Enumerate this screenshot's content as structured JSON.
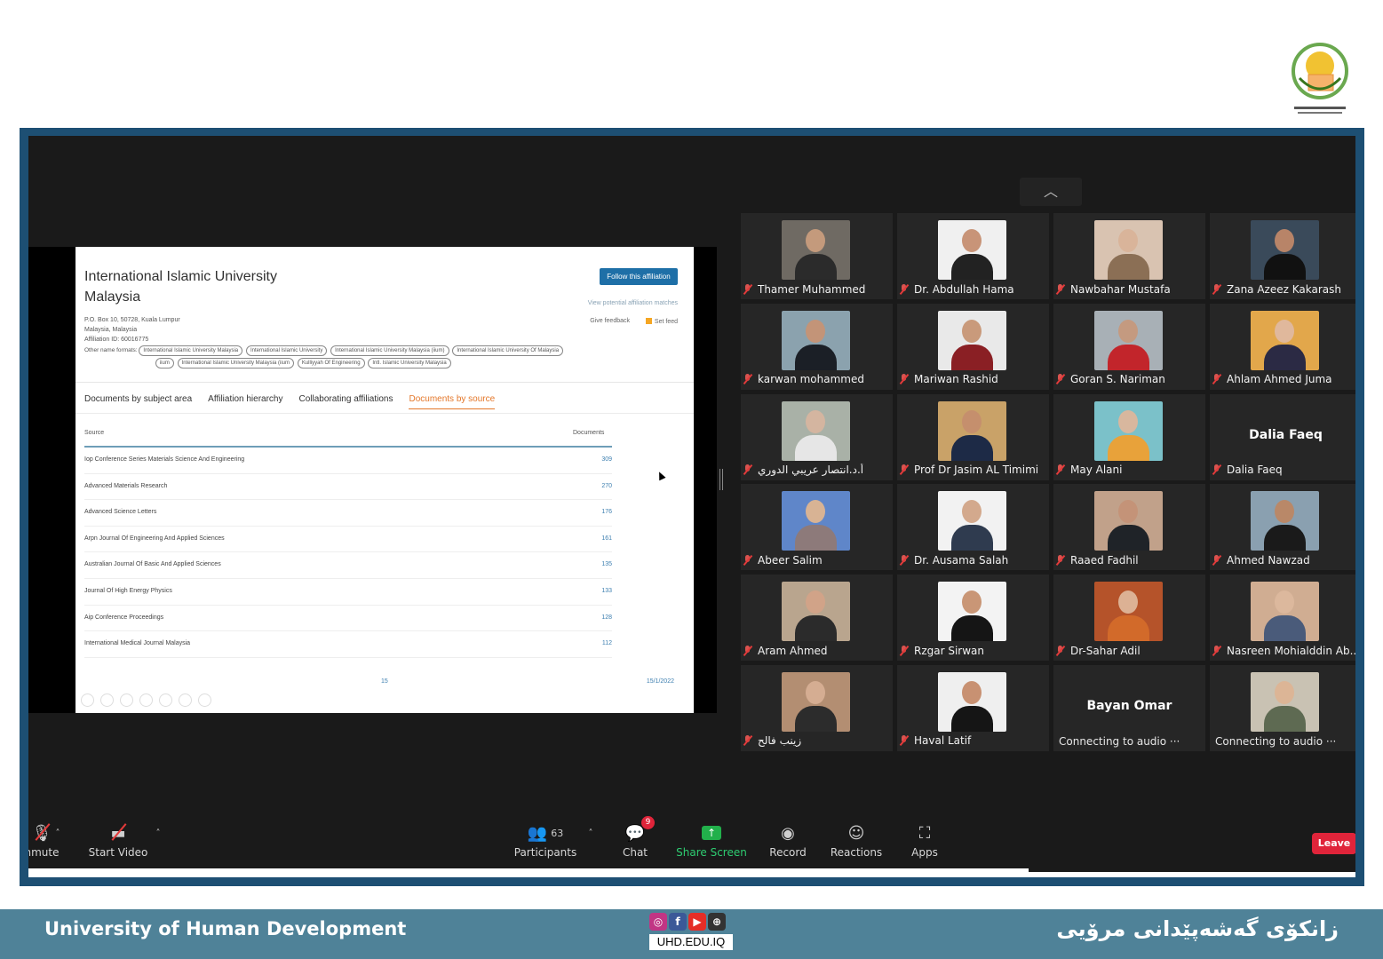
{
  "footer": {
    "left_text": "University of Human Development",
    "right_text": "زانکۆی گەشەپێدانی مرۆیی",
    "website": "UHD.EDU.IQ",
    "social_icons": [
      "instagram-icon",
      "facebook-icon",
      "youtube-icon",
      "web-icon"
    ]
  },
  "shared_doc": {
    "title": "International Islamic University Malaysia",
    "follow_button": "Follow this affiliation",
    "view_matches": "View potential affiliation matches",
    "give_feedback": "Give feedback",
    "set_feed": "Set feed",
    "address_line1": "P.O. Box 10, 50728, Kuala Lumpur",
    "address_line2": "Malaysia, Malaysia",
    "affiliation_id": "Affiliation ID: 60016775",
    "other_names_label": "Other name formats:",
    "other_names": [
      "International Islamic University Malaysia",
      "International Islamic University",
      "International Islamic University Malaysia (iium)",
      "International Islamic University Of Malaysia",
      "iium",
      "International Islamic University Malaysia (iium",
      "Kulliyyah Of Engineering",
      "Intl. Islamic University Malaysia"
    ],
    "tabs": [
      "Documents by subject area",
      "Affiliation hierarchy",
      "Collaborating affiliations",
      "Documents by source"
    ],
    "active_tab": "Documents by source",
    "col_source": "Source",
    "col_documents": "Documents",
    "rows": [
      {
        "source": "Iop Conference Series Materials Science And Engineering",
        "count": "309"
      },
      {
        "source": "Advanced Materials Research",
        "count": "270"
      },
      {
        "source": "Advanced Science Letters",
        "count": "176"
      },
      {
        "source": "Arpn Journal Of Engineering And Applied Sciences",
        "count": "161"
      },
      {
        "source": "Australian Journal Of Basic And Applied Sciences",
        "count": "135"
      },
      {
        "source": "Journal Of High Energy Physics",
        "count": "133"
      },
      {
        "source": "Aip Conference Proceedings",
        "count": "128"
      },
      {
        "source": "International Medical Journal Malaysia",
        "count": "112"
      }
    ],
    "page_number": "15",
    "date": "15/1/2022"
  },
  "participants": [
    {
      "name": "Thamer Muhammed",
      "bg": "#6f6a63",
      "skin": "#c49a7c",
      "shirt": "#2b2b2b"
    },
    {
      "name": "Dr. Abdullah Hama",
      "bg": "#f0f0f0",
      "skin": "#c89478",
      "shirt": "#222222"
    },
    {
      "name": "Nawbahar Mustafa",
      "bg": "#d9c3b1",
      "skin": "#d9b49a",
      "shirt": "#8b6f55"
    },
    {
      "name": "Zana Azeez Kakarash",
      "bg": "#3a4a5a",
      "skin": "#b88468",
      "shirt": "#111111"
    },
    {
      "name": "karwan mohammed",
      "bg": "#8ba2ae",
      "skin": "#c39478",
      "shirt": "#1b1f26"
    },
    {
      "name": "Mariwan Rashid",
      "bg": "#e9e9e9",
      "skin": "#c99a7b",
      "shirt": "#8a1f24"
    },
    {
      "name": "Goran S. Nariman",
      "bg": "#a8b0b6",
      "skin": "#c49a80",
      "shirt": "#c2252b"
    },
    {
      "name": "Ahlam Ahmed Juma",
      "bg": "#e2a74b",
      "skin": "#e0b89c",
      "shirt": "#2b2a44"
    },
    {
      "name": "أ.د.انتصار عريبي الدوري",
      "bg": "#a9b1a7",
      "skin": "#d4b5a0",
      "shirt": "#e6e6e6"
    },
    {
      "name": "Prof Dr Jasim AL Timimi",
      "bg": "#c9a268",
      "skin": "#c58f6d",
      "shirt": "#1d2a46"
    },
    {
      "name": "May Alani",
      "bg": "#7bc1c9",
      "skin": "#d8b79e",
      "shirt": "#e8a23a"
    },
    {
      "name": "Dalia Faeq",
      "text_only": true
    },
    {
      "name": "Abeer Salim",
      "bg": "#5f86c9",
      "skin": "#d8b394",
      "shirt": "#8d7a7a"
    },
    {
      "name": "Dr. Ausama Salah",
      "bg": "#f2f2f2",
      "skin": "#d3a98d",
      "shirt": "#2f3b4f"
    },
    {
      "name": "Raaed Fadhil",
      "bg": "#c1a18a",
      "skin": "#c49378",
      "shirt": "#1f2328"
    },
    {
      "name": "Ahmed Nawzad",
      "bg": "#8aa0b0",
      "skin": "#b98868",
      "shirt": "#1a1a1a"
    },
    {
      "name": "Aram Ahmed",
      "bg": "#b9a58e",
      "skin": "#d1a388",
      "shirt": "#2b2b2b"
    },
    {
      "name": "Rzgar Sirwan",
      "bg": "#f3f3f3",
      "skin": "#c99676",
      "shirt": "#151515"
    },
    {
      "name": "Dr-Sahar Adil",
      "bg": "#b5532a",
      "skin": "#dcb194",
      "shirt": "#d26a2a"
    },
    {
      "name": "Nasreen Mohialddin Ab...",
      "bg": "#d0ad92",
      "skin": "#dcb89d",
      "shirt": "#4a5b7a"
    },
    {
      "name": "زينب فالح",
      "bg": "#b38e72",
      "skin": "#d5ad92",
      "shirt": "#2c2c2c"
    },
    {
      "name": "Haval Latif",
      "bg": "#efefef",
      "skin": "#c89172",
      "shirt": "#151515"
    },
    {
      "name": "Bayan Omar",
      "text_only": true,
      "status": "Connecting to audio ···"
    },
    {
      "name": "",
      "bg": "#c9c2b3",
      "skin": "#dcb596",
      "shirt": "#5e6a52",
      "status": "Connecting to audio ···"
    }
  ],
  "toolbar": {
    "unmute": "nmute",
    "start_video": "Start Video",
    "participants": "Participants",
    "participant_count": "63",
    "chat": "Chat",
    "chat_badge": "9",
    "share_screen": "Share Screen",
    "record": "Record",
    "reactions": "Reactions",
    "apps": "Apps",
    "leave": "Leave"
  },
  "colors": {
    "frame": "#1d4f73",
    "footer": "#4f8298",
    "zoom_bg": "#1a1a1a",
    "share_green": "#22b04b",
    "leave_red": "#e0243a"
  }
}
